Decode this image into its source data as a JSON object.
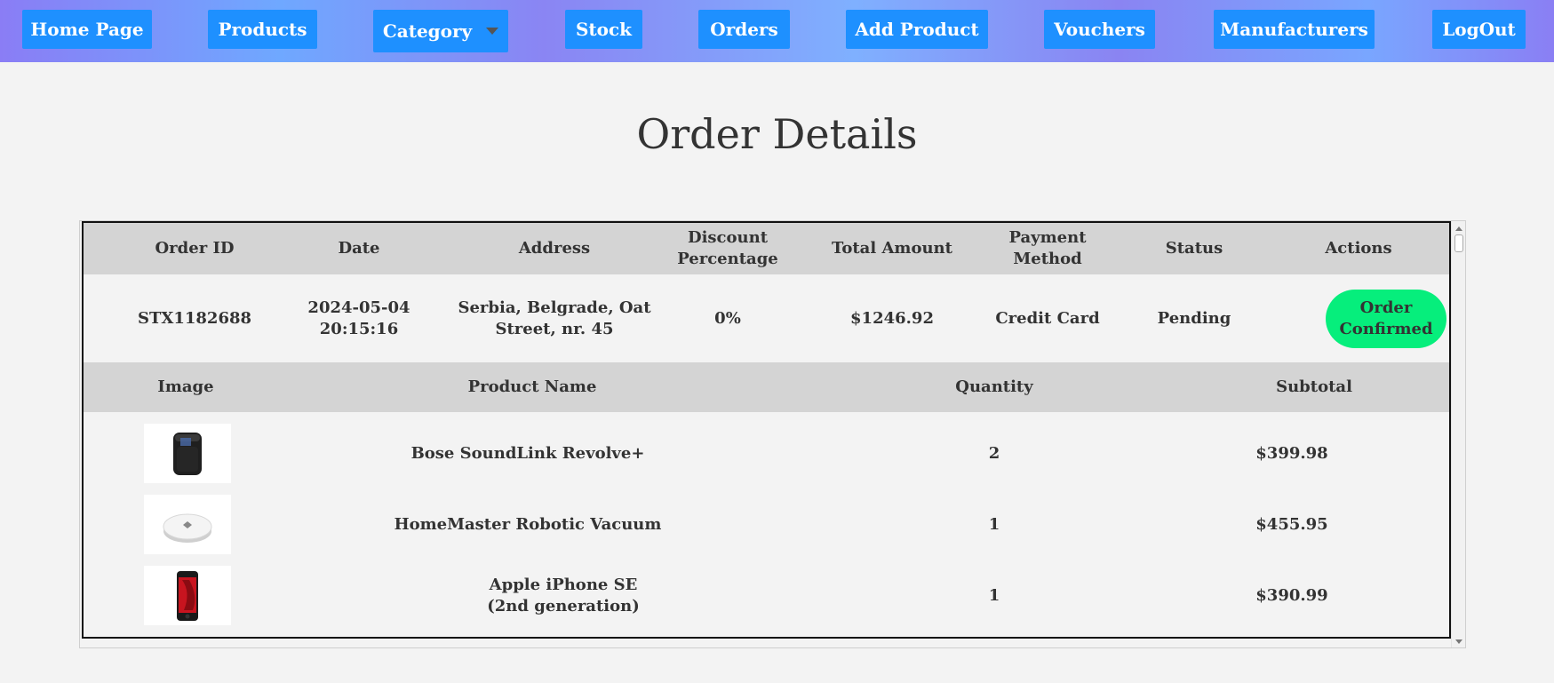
{
  "nav": {
    "home": "Home Page",
    "products": "Products",
    "category": "Category",
    "stock": "Stock",
    "orders": "Orders",
    "add_product": "Add Product",
    "vouchers": "Vouchers",
    "manufacturers": "Manufacturers",
    "logout": "LogOut"
  },
  "page_title": "Order Details",
  "order_headers": {
    "order_id": "Order ID",
    "date": "Date",
    "address": "Address",
    "discount": "Discount Percentage",
    "total": "Total Amount",
    "payment": "Payment Method",
    "status": "Status",
    "actions": "Actions"
  },
  "order": {
    "order_id": "STX1182688",
    "date": "2024-05-04 20:15:16",
    "address": "Serbia, Belgrade, Oat Street, nr. 45",
    "discount": "0%",
    "total": "$1246.92",
    "payment": "Credit Card",
    "status": "Pending",
    "action_label": "Order Confirmed",
    "action_color": "#06ee7c"
  },
  "item_headers": {
    "image": "Image",
    "product_name": "Product Name",
    "quantity": "Quantity",
    "subtotal": "Subtotal"
  },
  "items": [
    {
      "image_icon": "speaker-icon",
      "name": "Bose SoundLink Revolve+",
      "quantity": "2",
      "subtotal": "$399.98"
    },
    {
      "image_icon": "robot-vacuum-icon",
      "name": "HomeMaster Robotic Vacuum",
      "quantity": "1",
      "subtotal": "$455.95"
    },
    {
      "image_icon": "smartphone-icon",
      "name": "Apple iPhone SE (2nd generation)",
      "quantity": "1",
      "subtotal": "$390.99"
    }
  ],
  "colors": {
    "nav_button": "#1e90ff",
    "header_bg": "#d4d4d4",
    "confirm_button": "#06ee7c"
  }
}
